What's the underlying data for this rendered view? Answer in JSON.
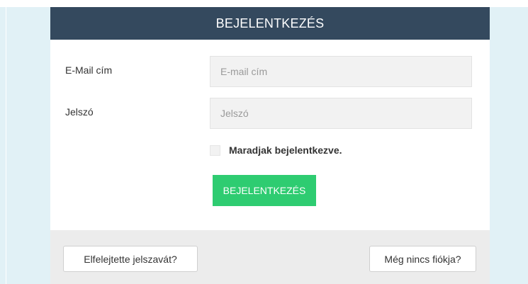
{
  "header": {
    "title": "BEJELENTKEZÉS"
  },
  "form": {
    "email": {
      "label": "E-Mail cím",
      "placeholder": "E-mail cím",
      "value": ""
    },
    "password": {
      "label": "Jelszó",
      "placeholder": "Jelszó",
      "value": ""
    },
    "remember": {
      "label": "Maradjak bejelentkezve.",
      "checked": false
    },
    "submit_label": "BEJELENTKEZÉS"
  },
  "footer": {
    "forgot_label": "Elfelejtette jelszavát?",
    "register_label": "Még nincs fiókja?"
  },
  "colors": {
    "header_bg": "#34495e",
    "button_green": "#2ecc71",
    "page_bg": "#e1f1f6",
    "footer_bg": "#ececec"
  }
}
